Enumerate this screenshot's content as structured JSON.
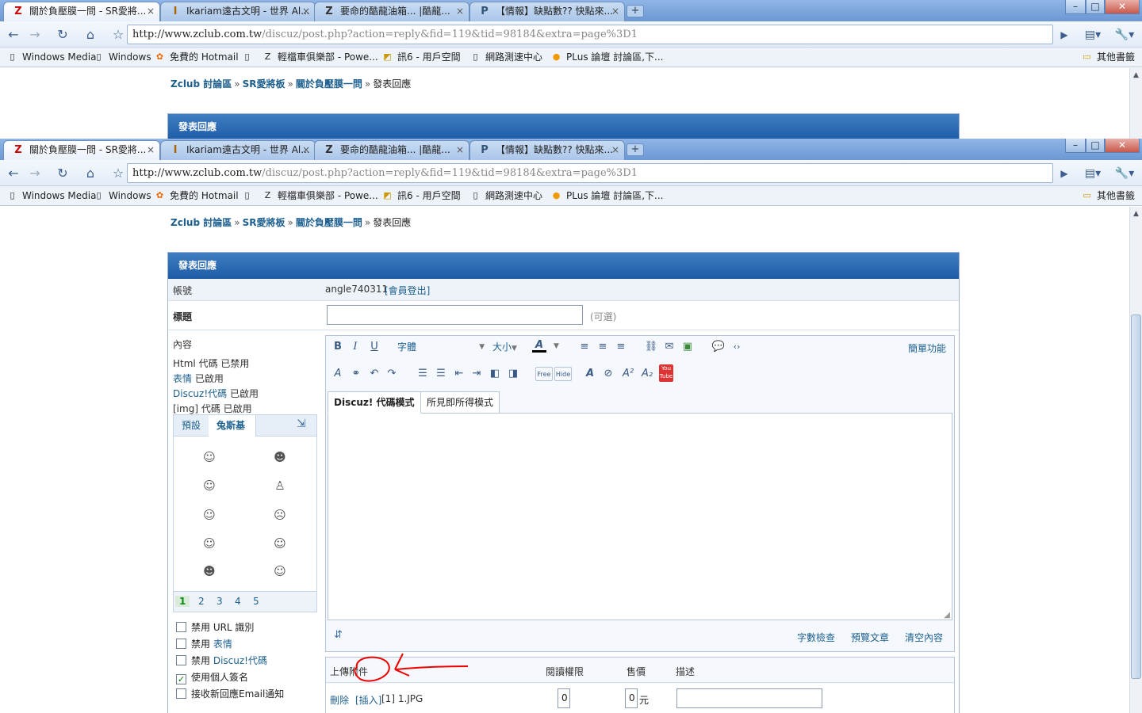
{
  "browser": {
    "tabs": [
      {
        "title": "關於負壓膜一問 - SR愛將...",
        "icon": "Z"
      },
      {
        "title": "Ikariam遠古文明 - 世界 Al...",
        "icon": "I"
      },
      {
        "title": "要命的酷龍油箱... |酷龍...",
        "icon": "Z"
      },
      {
        "title": "【情報】缺點數?? 快點來...",
        "icon": "P"
      }
    ],
    "new_tab": "+",
    "close": "×",
    "win_min": "–",
    "win_max": "□",
    "win_close": "✕",
    "url_host": "http://www.zclub.com.tw",
    "url_path": "/discuz/post.php?action=reply&fid=119&tid=98184&extra=page%3D1",
    "bookmarks": [
      "Windows Media",
      "Windows",
      "免費的 Hotmail",
      "",
      "輕檔車俱樂部 - Powe...",
      "訊6 - 用戶空間",
      "網路測速中心",
      "PLus 論壇 討論區,下..."
    ],
    "other_bookmarks": "其他書籤"
  },
  "page": {
    "breadcrumb": [
      "Zclub 討論區",
      "SR愛將板",
      "關於負壓膜一問",
      "發表回應"
    ],
    "crumb_sep": "»",
    "panel_title": "發表回應",
    "account_label": "帳號",
    "account_value": "angle740311",
    "logout": "[會員登出]",
    "title_label": "標題",
    "title_optional": "(可選)",
    "content_label": "內容",
    "html_code": "Html 代碼",
    "html_state": "已禁用",
    "smilies": "表情",
    "smilies_state": "已啟用",
    "discuz_code": "Discuz!代碼",
    "discuz_state": "已啟用",
    "img_code": "[img] 代碼",
    "img_state": "已啟用",
    "smiley_tabs": [
      "預設",
      "兔斯基"
    ],
    "smiley_pages": [
      "1",
      "2",
      "3",
      "4",
      "5"
    ],
    "options": [
      {
        "pre": "禁用 URL 識別",
        "link": "",
        "checked": false
      },
      {
        "pre": "禁用 ",
        "link": "表情",
        "checked": false
      },
      {
        "pre": "禁用 ",
        "link": "Discuz!代碼",
        "checked": false
      },
      {
        "pre": "使用個人簽名",
        "link": "",
        "checked": true
      },
      {
        "pre": "接收新回應Email通知",
        "link": "",
        "checked": false
      }
    ],
    "editor": {
      "font": "字體",
      "size": "大小",
      "simple": "簡單功能",
      "mode_code": "Discuz! 代碼模式",
      "mode_wysiwyg": "所見即所得模式",
      "word_check": "字數檢查",
      "preview": "預覽文章",
      "clear": "清空內容",
      "free": "Free",
      "hide": "Hide"
    },
    "attach": {
      "upload": "上傳附件",
      "read_perm": "閱讀權限",
      "price": "售價",
      "desc": "描述",
      "delete": "刪除",
      "insert": "[插入]",
      "file": "[1] 1.JPG",
      "perm_val": "0",
      "price_val": "0",
      "currency": "元"
    }
  },
  "colors": {
    "accent": "#1d5ba6",
    "link": "#1c5f8f",
    "annotation": "#e00000"
  }
}
